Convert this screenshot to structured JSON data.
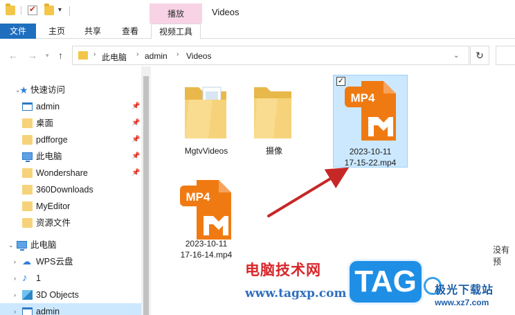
{
  "window": {
    "title": "Videos",
    "context_tab_header": "播放"
  },
  "ribbon": {
    "tabs": [
      "文件",
      "主页",
      "共享",
      "查看",
      "视频工具"
    ]
  },
  "address": {
    "crumbs": [
      "此电脑",
      "admin",
      "Videos"
    ]
  },
  "nav": {
    "quick_access": "快速访问",
    "pinned": [
      "admin",
      "桌面",
      "pdfforge",
      "此电脑",
      "Wondershare"
    ],
    "folders": [
      "360Downloads",
      "MyEditor",
      "资源文件"
    ],
    "this_pc": "此电脑",
    "pc_items": [
      "WPS云盘",
      "1",
      "3D Objects",
      "admin"
    ]
  },
  "files": [
    {
      "name": "MgtvVideos",
      "type": "folder"
    },
    {
      "name": "摄像",
      "type": "folder"
    },
    {
      "name": "2023-10-11\n17-15-22.mp4",
      "type": "mp4",
      "selected": true
    },
    {
      "name": "2023-10-11\n17-16-14.mp4",
      "type": "mp4",
      "selected": false
    }
  ],
  "file_badge": "MP4",
  "empty_text": "没有预",
  "watermark": {
    "cn": "电脑技术网",
    "url": "www.tagxp.com",
    "tag": "TAG",
    "site_name": "极光下载站",
    "site_url": "www.xz7.com"
  },
  "colors": {
    "accent": "#1f6fbf",
    "mp4_orange": "#f07a12",
    "arrow": "#c62828",
    "selection": "#cce8ff"
  }
}
